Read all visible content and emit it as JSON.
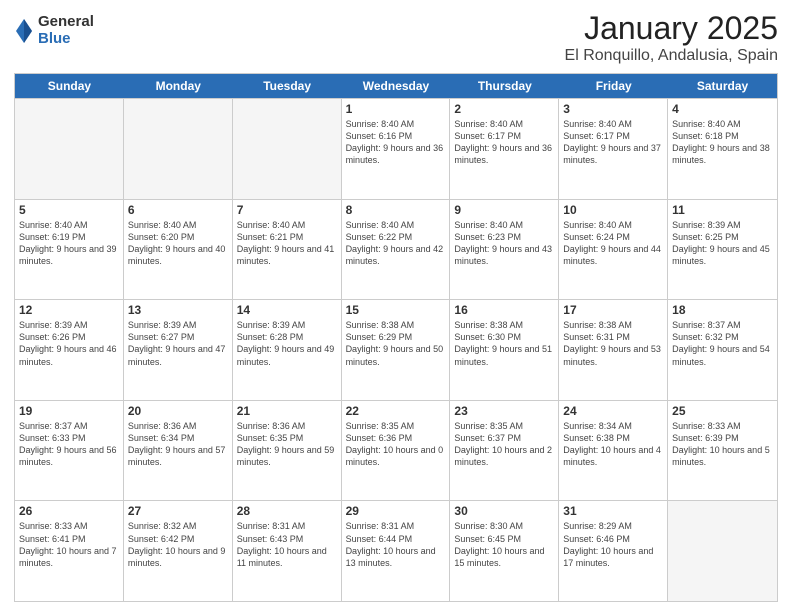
{
  "logo": {
    "general": "General",
    "blue": "Blue"
  },
  "title": "January 2025",
  "subtitle": "El Ronquillo, Andalusia, Spain",
  "days": [
    "Sunday",
    "Monday",
    "Tuesday",
    "Wednesday",
    "Thursday",
    "Friday",
    "Saturday"
  ],
  "weeks": [
    [
      {
        "day": "",
        "empty": true
      },
      {
        "day": "",
        "empty": true
      },
      {
        "day": "",
        "empty": true
      },
      {
        "day": "1",
        "sunrise": "Sunrise: 8:40 AM",
        "sunset": "Sunset: 6:16 PM",
        "daylight": "Daylight: 9 hours and 36 minutes."
      },
      {
        "day": "2",
        "sunrise": "Sunrise: 8:40 AM",
        "sunset": "Sunset: 6:17 PM",
        "daylight": "Daylight: 9 hours and 36 minutes."
      },
      {
        "day": "3",
        "sunrise": "Sunrise: 8:40 AM",
        "sunset": "Sunset: 6:17 PM",
        "daylight": "Daylight: 9 hours and 37 minutes."
      },
      {
        "day": "4",
        "sunrise": "Sunrise: 8:40 AM",
        "sunset": "Sunset: 6:18 PM",
        "daylight": "Daylight: 9 hours and 38 minutes."
      }
    ],
    [
      {
        "day": "5",
        "sunrise": "Sunrise: 8:40 AM",
        "sunset": "Sunset: 6:19 PM",
        "daylight": "Daylight: 9 hours and 39 minutes."
      },
      {
        "day": "6",
        "sunrise": "Sunrise: 8:40 AM",
        "sunset": "Sunset: 6:20 PM",
        "daylight": "Daylight: 9 hours and 40 minutes."
      },
      {
        "day": "7",
        "sunrise": "Sunrise: 8:40 AM",
        "sunset": "Sunset: 6:21 PM",
        "daylight": "Daylight: 9 hours and 41 minutes."
      },
      {
        "day": "8",
        "sunrise": "Sunrise: 8:40 AM",
        "sunset": "Sunset: 6:22 PM",
        "daylight": "Daylight: 9 hours and 42 minutes."
      },
      {
        "day": "9",
        "sunrise": "Sunrise: 8:40 AM",
        "sunset": "Sunset: 6:23 PM",
        "daylight": "Daylight: 9 hours and 43 minutes."
      },
      {
        "day": "10",
        "sunrise": "Sunrise: 8:40 AM",
        "sunset": "Sunset: 6:24 PM",
        "daylight": "Daylight: 9 hours and 44 minutes."
      },
      {
        "day": "11",
        "sunrise": "Sunrise: 8:39 AM",
        "sunset": "Sunset: 6:25 PM",
        "daylight": "Daylight: 9 hours and 45 minutes."
      }
    ],
    [
      {
        "day": "12",
        "sunrise": "Sunrise: 8:39 AM",
        "sunset": "Sunset: 6:26 PM",
        "daylight": "Daylight: 9 hours and 46 minutes."
      },
      {
        "day": "13",
        "sunrise": "Sunrise: 8:39 AM",
        "sunset": "Sunset: 6:27 PM",
        "daylight": "Daylight: 9 hours and 47 minutes."
      },
      {
        "day": "14",
        "sunrise": "Sunrise: 8:39 AM",
        "sunset": "Sunset: 6:28 PM",
        "daylight": "Daylight: 9 hours and 49 minutes."
      },
      {
        "day": "15",
        "sunrise": "Sunrise: 8:38 AM",
        "sunset": "Sunset: 6:29 PM",
        "daylight": "Daylight: 9 hours and 50 minutes."
      },
      {
        "day": "16",
        "sunrise": "Sunrise: 8:38 AM",
        "sunset": "Sunset: 6:30 PM",
        "daylight": "Daylight: 9 hours and 51 minutes."
      },
      {
        "day": "17",
        "sunrise": "Sunrise: 8:38 AM",
        "sunset": "Sunset: 6:31 PM",
        "daylight": "Daylight: 9 hours and 53 minutes."
      },
      {
        "day": "18",
        "sunrise": "Sunrise: 8:37 AM",
        "sunset": "Sunset: 6:32 PM",
        "daylight": "Daylight: 9 hours and 54 minutes."
      }
    ],
    [
      {
        "day": "19",
        "sunrise": "Sunrise: 8:37 AM",
        "sunset": "Sunset: 6:33 PM",
        "daylight": "Daylight: 9 hours and 56 minutes."
      },
      {
        "day": "20",
        "sunrise": "Sunrise: 8:36 AM",
        "sunset": "Sunset: 6:34 PM",
        "daylight": "Daylight: 9 hours and 57 minutes."
      },
      {
        "day": "21",
        "sunrise": "Sunrise: 8:36 AM",
        "sunset": "Sunset: 6:35 PM",
        "daylight": "Daylight: 9 hours and 59 minutes."
      },
      {
        "day": "22",
        "sunrise": "Sunrise: 8:35 AM",
        "sunset": "Sunset: 6:36 PM",
        "daylight": "Daylight: 10 hours and 0 minutes."
      },
      {
        "day": "23",
        "sunrise": "Sunrise: 8:35 AM",
        "sunset": "Sunset: 6:37 PM",
        "daylight": "Daylight: 10 hours and 2 minutes."
      },
      {
        "day": "24",
        "sunrise": "Sunrise: 8:34 AM",
        "sunset": "Sunset: 6:38 PM",
        "daylight": "Daylight: 10 hours and 4 minutes."
      },
      {
        "day": "25",
        "sunrise": "Sunrise: 8:33 AM",
        "sunset": "Sunset: 6:39 PM",
        "daylight": "Daylight: 10 hours and 5 minutes."
      }
    ],
    [
      {
        "day": "26",
        "sunrise": "Sunrise: 8:33 AM",
        "sunset": "Sunset: 6:41 PM",
        "daylight": "Daylight: 10 hours and 7 minutes."
      },
      {
        "day": "27",
        "sunrise": "Sunrise: 8:32 AM",
        "sunset": "Sunset: 6:42 PM",
        "daylight": "Daylight: 10 hours and 9 minutes."
      },
      {
        "day": "28",
        "sunrise": "Sunrise: 8:31 AM",
        "sunset": "Sunset: 6:43 PM",
        "daylight": "Daylight: 10 hours and 11 minutes."
      },
      {
        "day": "29",
        "sunrise": "Sunrise: 8:31 AM",
        "sunset": "Sunset: 6:44 PM",
        "daylight": "Daylight: 10 hours and 13 minutes."
      },
      {
        "day": "30",
        "sunrise": "Sunrise: 8:30 AM",
        "sunset": "Sunset: 6:45 PM",
        "daylight": "Daylight: 10 hours and 15 minutes."
      },
      {
        "day": "31",
        "sunrise": "Sunrise: 8:29 AM",
        "sunset": "Sunset: 6:46 PM",
        "daylight": "Daylight: 10 hours and 17 minutes."
      },
      {
        "day": "",
        "empty": true
      }
    ]
  ]
}
